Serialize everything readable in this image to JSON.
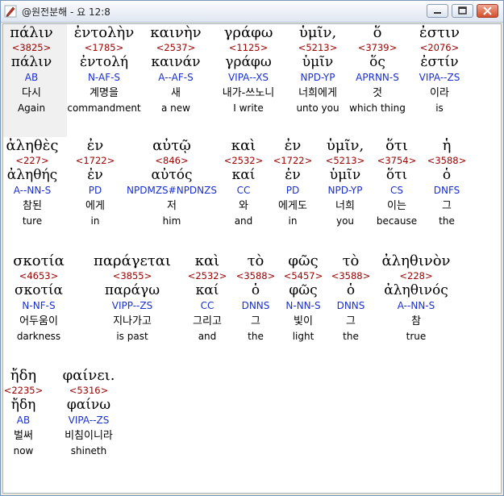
{
  "window": {
    "title": "@원전분해 - 요 12:8"
  },
  "verse_rows": [
    {
      "words": [
        {
          "greek": "πάλιν",
          "strongs": "<3825>",
          "lemma": "πάλιν",
          "parse": "AB",
          "korean": "다시",
          "english": "Again"
        },
        {
          "greek": "ἐντολὴν",
          "strongs": "<1785>",
          "lemma": "ἐντολή",
          "parse": "N-AF-S",
          "korean": "계명을",
          "english": "commandment"
        },
        {
          "greek": "καινὴν",
          "strongs": "<2537>",
          "lemma": "καινάν",
          "parse": "A--AF-S",
          "korean": "새",
          "english": "a new"
        },
        {
          "greek": "γράφω",
          "strongs": "<1125>",
          "lemma": "γράφω",
          "parse": "VIPA--XS",
          "korean": "내가-쓰노니",
          "english": "I write"
        },
        {
          "greek": "ὑμῖν,",
          "strongs": "<5213>",
          "lemma": "ὑμῖν",
          "parse": "NPD-YP",
          "korean": "너희에게",
          "english": "unto you"
        },
        {
          "greek": "ὅ",
          "strongs": "<3739>",
          "lemma": "ὅς",
          "parse": "APRNN-S",
          "korean": "것",
          "english": "which thing"
        },
        {
          "greek": "ἐστιν",
          "strongs": "<2076>",
          "lemma": "ἐστίν",
          "parse": "VIPA--ZS",
          "korean": "이라",
          "english": "is"
        }
      ]
    },
    {
      "words": [
        {
          "greek": "ἀληθὲς",
          "strongs": "<227>",
          "lemma": "ἀληθής",
          "parse": "A--NN-S",
          "korean": "참된",
          "english": "ture"
        },
        {
          "greek": "ἐν",
          "strongs": "<1722>",
          "lemma": "ἐν",
          "parse": "PD",
          "korean": "에게",
          "english": "in"
        },
        {
          "greek": "αὐτῷ",
          "strongs": "<846>",
          "lemma": "αὐτός",
          "parse": "NPDMZS#NPDNZS",
          "korean": "저",
          "english": "him"
        },
        {
          "greek": "καὶ",
          "strongs": "<2532>",
          "lemma": "καί",
          "parse": "CC",
          "korean": "와",
          "english": "and"
        },
        {
          "greek": "ἐν",
          "strongs": "<1722>",
          "lemma": "ἐν",
          "parse": "PD",
          "korean": "에게도",
          "english": "in"
        },
        {
          "greek": "ὑμῖν,",
          "strongs": "<5213>",
          "lemma": "ὑμῖν",
          "parse": "NPD-YP",
          "korean": "너희",
          "english": "you"
        },
        {
          "greek": "ὅτι",
          "strongs": "<3754>",
          "lemma": "ὅτι",
          "parse": "CS",
          "korean": "이는",
          "english": "because"
        },
        {
          "greek": "ἡ",
          "strongs": "<3588>",
          "lemma": "ὁ",
          "parse": "DNFS",
          "korean": "그",
          "english": "the"
        }
      ]
    },
    {
      "words": [
        {
          "greek": "σκοτία",
          "strongs": "<4653>",
          "lemma": "σκοτία",
          "parse": "N-NF-S",
          "korean": "어두움이",
          "english": "darkness"
        },
        {
          "greek": "παράγεται",
          "strongs": "<3855>",
          "lemma": "παράγω",
          "parse": "VIPP--ZS",
          "korean": "지나가고",
          "english": "is past"
        },
        {
          "greek": "καὶ",
          "strongs": "<2532>",
          "lemma": "καί",
          "parse": "CC",
          "korean": "그리고",
          "english": "and"
        },
        {
          "greek": "τὸ",
          "strongs": "<3588>",
          "lemma": "ὁ",
          "parse": "DNNS",
          "korean": "그",
          "english": "the"
        },
        {
          "greek": "φῶς",
          "strongs": "<5457>",
          "lemma": "φῶς",
          "parse": "N-NN-S",
          "korean": "빛이",
          "english": "light"
        },
        {
          "greek": "τὸ",
          "strongs": "<3588>",
          "lemma": "ὁ",
          "parse": "DNNS",
          "korean": "그",
          "english": "the"
        },
        {
          "greek": "ἀληθινὸν",
          "strongs": "<228>",
          "lemma": "ἀληθινός",
          "parse": "A--NN-S",
          "korean": "참",
          "english": "true"
        }
      ]
    },
    {
      "words": [
        {
          "greek": "ἤδη",
          "strongs": "<2235>",
          "lemma": "ἤδη",
          "parse": "AB",
          "korean": "벌써",
          "english": "now"
        },
        {
          "greek": "φαίνει.",
          "strongs": "<5316>",
          "lemma": "φαίνω",
          "parse": "VIPA--ZS",
          "korean": "비침이니라",
          "english": "shineth"
        }
      ]
    }
  ]
}
